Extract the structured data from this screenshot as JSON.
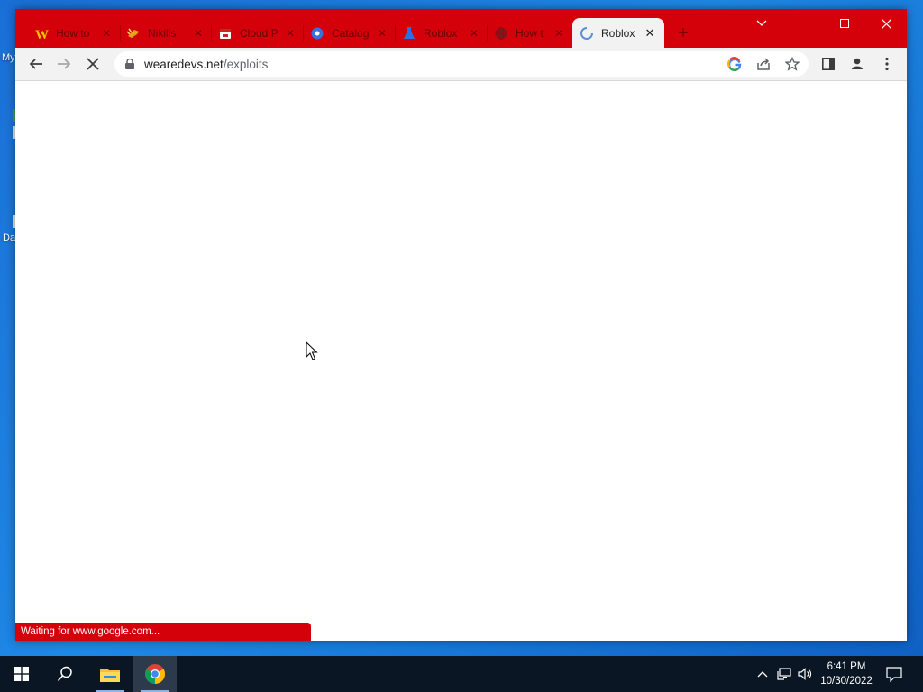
{
  "desktop": {
    "label_1": "My",
    "label_2": "Da"
  },
  "browser": {
    "tabs": [
      {
        "title": "How to",
        "favicon": "w-logo-icon",
        "active": false
      },
      {
        "title": "Nikilis",
        "favicon": "winged-shoe-icon",
        "active": false
      },
      {
        "title": "Cloud Pr",
        "favicon": "red-box-icon",
        "active": false
      },
      {
        "title": "Catalog",
        "favicon": "gear-star-icon",
        "active": false
      },
      {
        "title": "Roblox",
        "favicon": "flask-icon",
        "active": false
      },
      {
        "title": "How t",
        "favicon": "globe-icon",
        "active": false
      },
      {
        "title": "Roblox",
        "favicon": "loading-spinner-icon",
        "active": true
      }
    ],
    "url_host": "wearedevs.net",
    "url_path": "/exploits",
    "status_text": "Waiting for www.google.com...",
    "colors": {
      "frame": "#d4000a",
      "toolbar": "#f2f2f2"
    }
  },
  "taskbar": {
    "time": "6:41 PM",
    "date": "10/30/2022"
  }
}
